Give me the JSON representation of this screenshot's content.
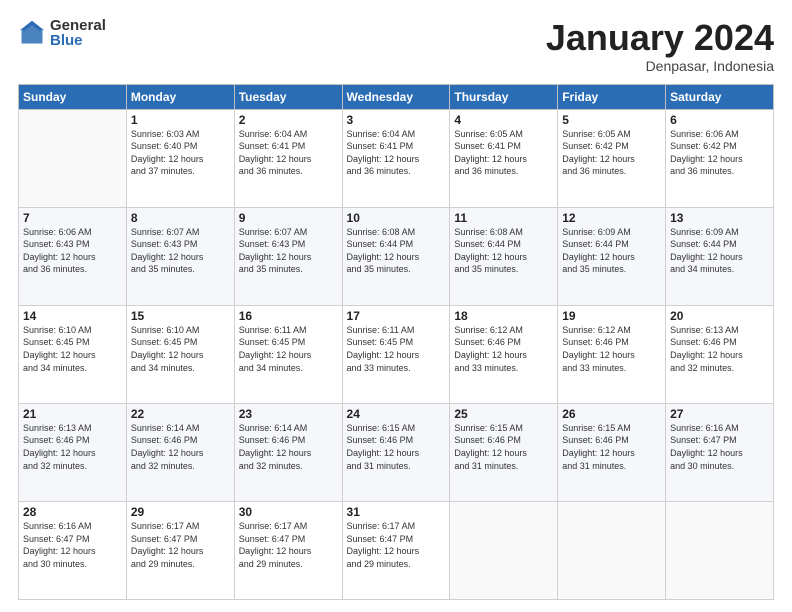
{
  "logo": {
    "general": "General",
    "blue": "Blue"
  },
  "header": {
    "month": "January 2024",
    "location": "Denpasar, Indonesia"
  },
  "weekdays": [
    "Sunday",
    "Monday",
    "Tuesday",
    "Wednesday",
    "Thursday",
    "Friday",
    "Saturday"
  ],
  "weeks": [
    [
      {
        "day": "",
        "sunrise": "",
        "sunset": "",
        "daylight": ""
      },
      {
        "day": "1",
        "sunrise": "Sunrise: 6:03 AM",
        "sunset": "Sunset: 6:40 PM",
        "daylight": "Daylight: 12 hours and 37 minutes."
      },
      {
        "day": "2",
        "sunrise": "Sunrise: 6:04 AM",
        "sunset": "Sunset: 6:41 PM",
        "daylight": "Daylight: 12 hours and 36 minutes."
      },
      {
        "day": "3",
        "sunrise": "Sunrise: 6:04 AM",
        "sunset": "Sunset: 6:41 PM",
        "daylight": "Daylight: 12 hours and 36 minutes."
      },
      {
        "day": "4",
        "sunrise": "Sunrise: 6:05 AM",
        "sunset": "Sunset: 6:41 PM",
        "daylight": "Daylight: 12 hours and 36 minutes."
      },
      {
        "day": "5",
        "sunrise": "Sunrise: 6:05 AM",
        "sunset": "Sunset: 6:42 PM",
        "daylight": "Daylight: 12 hours and 36 minutes."
      },
      {
        "day": "6",
        "sunrise": "Sunrise: 6:06 AM",
        "sunset": "Sunset: 6:42 PM",
        "daylight": "Daylight: 12 hours and 36 minutes."
      }
    ],
    [
      {
        "day": "7",
        "sunrise": "Sunrise: 6:06 AM",
        "sunset": "Sunset: 6:43 PM",
        "daylight": "Daylight: 12 hours and 36 minutes."
      },
      {
        "day": "8",
        "sunrise": "Sunrise: 6:07 AM",
        "sunset": "Sunset: 6:43 PM",
        "daylight": "Daylight: 12 hours and 35 minutes."
      },
      {
        "day": "9",
        "sunrise": "Sunrise: 6:07 AM",
        "sunset": "Sunset: 6:43 PM",
        "daylight": "Daylight: 12 hours and 35 minutes."
      },
      {
        "day": "10",
        "sunrise": "Sunrise: 6:08 AM",
        "sunset": "Sunset: 6:44 PM",
        "daylight": "Daylight: 12 hours and 35 minutes."
      },
      {
        "day": "11",
        "sunrise": "Sunrise: 6:08 AM",
        "sunset": "Sunset: 6:44 PM",
        "daylight": "Daylight: 12 hours and 35 minutes."
      },
      {
        "day": "12",
        "sunrise": "Sunrise: 6:09 AM",
        "sunset": "Sunset: 6:44 PM",
        "daylight": "Daylight: 12 hours and 35 minutes."
      },
      {
        "day": "13",
        "sunrise": "Sunrise: 6:09 AM",
        "sunset": "Sunset: 6:44 PM",
        "daylight": "Daylight: 12 hours and 34 minutes."
      }
    ],
    [
      {
        "day": "14",
        "sunrise": "Sunrise: 6:10 AM",
        "sunset": "Sunset: 6:45 PM",
        "daylight": "Daylight: 12 hours and 34 minutes."
      },
      {
        "day": "15",
        "sunrise": "Sunrise: 6:10 AM",
        "sunset": "Sunset: 6:45 PM",
        "daylight": "Daylight: 12 hours and 34 minutes."
      },
      {
        "day": "16",
        "sunrise": "Sunrise: 6:11 AM",
        "sunset": "Sunset: 6:45 PM",
        "daylight": "Daylight: 12 hours and 34 minutes."
      },
      {
        "day": "17",
        "sunrise": "Sunrise: 6:11 AM",
        "sunset": "Sunset: 6:45 PM",
        "daylight": "Daylight: 12 hours and 33 minutes."
      },
      {
        "day": "18",
        "sunrise": "Sunrise: 6:12 AM",
        "sunset": "Sunset: 6:46 PM",
        "daylight": "Daylight: 12 hours and 33 minutes."
      },
      {
        "day": "19",
        "sunrise": "Sunrise: 6:12 AM",
        "sunset": "Sunset: 6:46 PM",
        "daylight": "Daylight: 12 hours and 33 minutes."
      },
      {
        "day": "20",
        "sunrise": "Sunrise: 6:13 AM",
        "sunset": "Sunset: 6:46 PM",
        "daylight": "Daylight: 12 hours and 32 minutes."
      }
    ],
    [
      {
        "day": "21",
        "sunrise": "Sunrise: 6:13 AM",
        "sunset": "Sunset: 6:46 PM",
        "daylight": "Daylight: 12 hours and 32 minutes."
      },
      {
        "day": "22",
        "sunrise": "Sunrise: 6:14 AM",
        "sunset": "Sunset: 6:46 PM",
        "daylight": "Daylight: 12 hours and 32 minutes."
      },
      {
        "day": "23",
        "sunrise": "Sunrise: 6:14 AM",
        "sunset": "Sunset: 6:46 PM",
        "daylight": "Daylight: 12 hours and 32 minutes."
      },
      {
        "day": "24",
        "sunrise": "Sunrise: 6:15 AM",
        "sunset": "Sunset: 6:46 PM",
        "daylight": "Daylight: 12 hours and 31 minutes."
      },
      {
        "day": "25",
        "sunrise": "Sunrise: 6:15 AM",
        "sunset": "Sunset: 6:46 PM",
        "daylight": "Daylight: 12 hours and 31 minutes."
      },
      {
        "day": "26",
        "sunrise": "Sunrise: 6:15 AM",
        "sunset": "Sunset: 6:46 PM",
        "daylight": "Daylight: 12 hours and 31 minutes."
      },
      {
        "day": "27",
        "sunrise": "Sunrise: 6:16 AM",
        "sunset": "Sunset: 6:47 PM",
        "daylight": "Daylight: 12 hours and 30 minutes."
      }
    ],
    [
      {
        "day": "28",
        "sunrise": "Sunrise: 6:16 AM",
        "sunset": "Sunset: 6:47 PM",
        "daylight": "Daylight: 12 hours and 30 minutes."
      },
      {
        "day": "29",
        "sunrise": "Sunrise: 6:17 AM",
        "sunset": "Sunset: 6:47 PM",
        "daylight": "Daylight: 12 hours and 29 minutes."
      },
      {
        "day": "30",
        "sunrise": "Sunrise: 6:17 AM",
        "sunset": "Sunset: 6:47 PM",
        "daylight": "Daylight: 12 hours and 29 minutes."
      },
      {
        "day": "31",
        "sunrise": "Sunrise: 6:17 AM",
        "sunset": "Sunset: 6:47 PM",
        "daylight": "Daylight: 12 hours and 29 minutes."
      },
      {
        "day": "",
        "sunrise": "",
        "sunset": "",
        "daylight": ""
      },
      {
        "day": "",
        "sunrise": "",
        "sunset": "",
        "daylight": ""
      },
      {
        "day": "",
        "sunrise": "",
        "sunset": "",
        "daylight": ""
      }
    ]
  ]
}
